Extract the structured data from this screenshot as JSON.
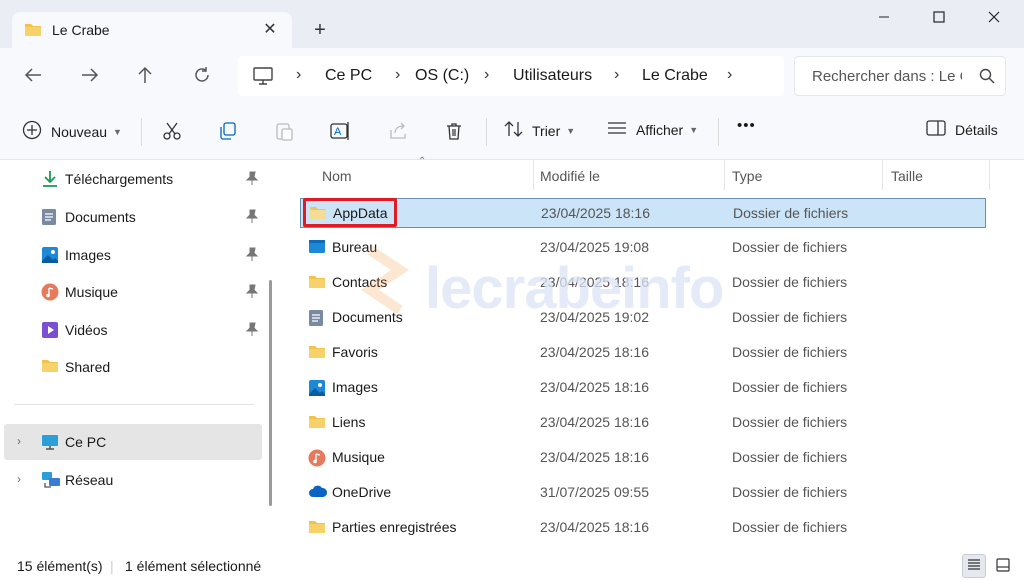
{
  "window": {
    "tab_title": "Le Crabe",
    "tab_close": "✕",
    "new_tab": "+",
    "minimize_icon": "minimize-icon",
    "maximize_icon": "maximize-icon",
    "close_icon": "close-icon"
  },
  "nav": {
    "breadcrumb": [
      "Ce PC",
      "OS (C:)",
      "Utilisateurs",
      "Le Crabe"
    ],
    "breadcrumb_separator": "›",
    "search_placeholder": "Rechercher dans : Le Crabe"
  },
  "commands": {
    "new_label": "Nouveau",
    "sort_label": "Trier",
    "view_label": "Afficher",
    "more_label": "•••",
    "details_label": "Détails"
  },
  "sidebar": {
    "items": [
      {
        "label": "Téléchargements",
        "icon": "download-icon",
        "pinned": true
      },
      {
        "label": "Documents",
        "icon": "documents-icon",
        "pinned": true
      },
      {
        "label": "Images",
        "icon": "images-icon",
        "pinned": true
      },
      {
        "label": "Musique",
        "icon": "music-icon",
        "pinned": true
      },
      {
        "label": "Vidéos",
        "icon": "videos-icon",
        "pinned": true
      },
      {
        "label": "Shared",
        "icon": "folder-icon",
        "pinned": false
      }
    ],
    "locations": [
      {
        "label": "Ce PC",
        "icon": "computer-icon"
      },
      {
        "label": "Réseau",
        "icon": "network-icon"
      }
    ]
  },
  "list": {
    "columns": [
      "Nom",
      "Modifié le",
      "Type",
      "Taille"
    ],
    "rows": [
      {
        "name": "AppData",
        "date": "23/04/2025 18:16",
        "type": "Dossier de fichiers",
        "icon": "folder-icon",
        "selected": true
      },
      {
        "name": "Bureau",
        "date": "23/04/2025 19:08",
        "type": "Dossier de fichiers",
        "icon": "desktop-icon"
      },
      {
        "name": "Contacts",
        "date": "23/04/2025 18:16",
        "type": "Dossier de fichiers",
        "icon": "folder-icon"
      },
      {
        "name": "Documents",
        "date": "23/04/2025 19:02",
        "type": "Dossier de fichiers",
        "icon": "documents-icon"
      },
      {
        "name": "Favoris",
        "date": "23/04/2025 18:16",
        "type": "Dossier de fichiers",
        "icon": "folder-icon"
      },
      {
        "name": "Images",
        "date": "23/04/2025 18:16",
        "type": "Dossier de fichiers",
        "icon": "images-icon"
      },
      {
        "name": "Liens",
        "date": "23/04/2025 18:16",
        "type": "Dossier de fichiers",
        "icon": "folder-icon"
      },
      {
        "name": "Musique",
        "date": "23/04/2025 18:16",
        "type": "Dossier de fichiers",
        "icon": "music-icon"
      },
      {
        "name": "OneDrive",
        "date": "31/07/2025 09:55",
        "type": "Dossier de fichiers",
        "icon": "onedrive-icon"
      },
      {
        "name": "Parties enregistrées",
        "date": "23/04/2025 18:16",
        "type": "Dossier de fichiers",
        "icon": "folder-icon"
      }
    ]
  },
  "status": {
    "count": "15 élément(s)",
    "selection": "1 élément sélectionné"
  },
  "watermark": "lecrabeinfo",
  "colors": {
    "folder": "#f2c24b",
    "selection": "#cce4f7",
    "highlight": "#e01b24",
    "accent": "#0067c0"
  }
}
